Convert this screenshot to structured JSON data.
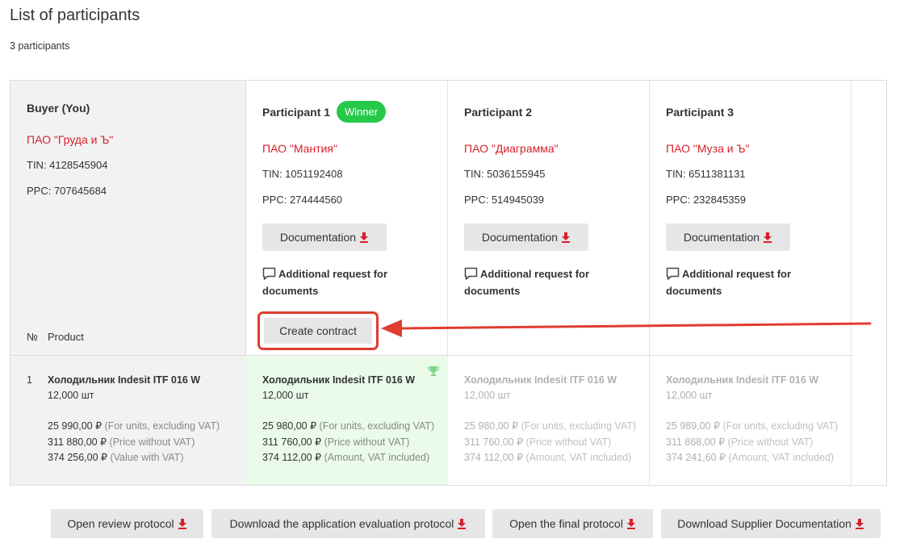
{
  "page": {
    "title": "List of participants",
    "count": "3 participants"
  },
  "buyer": {
    "heading": "Buyer (You)",
    "org": "ПАО \"Груда и Ъ\"",
    "tin": "TIN: 4128545904",
    "ppc": "PPC: 707645684",
    "col_no": "№",
    "col_product": "Product"
  },
  "participants": [
    {
      "heading": "Participant 1",
      "badge": "Winner",
      "org": "ПАО \"Мантия\"",
      "tin": "TIN: 1051192408",
      "ppc": "PPC: 274444560",
      "doc_label": "Documentation",
      "request_label": "Additional request for documents",
      "create_label": "Create contract",
      "item_name": "Холодильник Indesit ITF 016 W",
      "item_qty": "12,000 шт",
      "price_unit": "25 980,00 ₽",
      "price_unit_lbl": "(For units, excluding VAT)",
      "price_novat": "311 760,00 ₽",
      "price_novat_lbl": "(Price without VAT)",
      "price_vat": "374 112,00 ₽",
      "price_vat_lbl": "(Amount, VAT included)"
    },
    {
      "heading": "Participant 2",
      "org": "ПАО \"Диаграмма\"",
      "tin": "TIN: 5036155945",
      "ppc": "PPC: 514945039",
      "doc_label": "Documentation",
      "request_label": "Additional request for documents",
      "item_name": "Холодильник Indesit ITF 016 W",
      "item_qty": "12,000 шт",
      "price_unit": "25 980,00 ₽",
      "price_unit_lbl": "(For units, excluding VAT)",
      "price_novat": "311 760,00 ₽",
      "price_novat_lbl": "(Price without VAT)",
      "price_vat": "374 112,00 ₽",
      "price_vat_lbl": "(Amount, VAT included)"
    },
    {
      "heading": "Participant 3",
      "org": "ПАО \"Муза и Ъ\"",
      "tin": "TIN: 6511381131",
      "ppc": "PPC: 232845359",
      "doc_label": "Documentation",
      "request_label": "Additional request for documents",
      "item_name": "Холодильник Indesit ITF 016 W",
      "item_qty": "12,000 шт",
      "price_unit": "25 989,00 ₽",
      "price_unit_lbl": "(For units, excluding VAT)",
      "price_novat": "311 868,00 ₽",
      "price_novat_lbl": "(Price without VAT)",
      "price_vat": "374 241,60 ₽",
      "price_vat_lbl": "(Amount, VAT included)"
    }
  ],
  "buyer_item": {
    "no": "1",
    "name": "Холодильник Indesit ITF 016 W",
    "qty": "12,000 шт",
    "price_unit": "25 990,00 ₽",
    "price_unit_lbl": "(For units, excluding VAT)",
    "price_novat": "311 880,00 ₽",
    "price_novat_lbl": "(Price without VAT)",
    "price_vat": "374 256,00 ₽",
    "price_vat_lbl": "(Value with VAT)"
  },
  "bottom_buttons": {
    "review": "Open review protocol",
    "evaluation": "Download the application evaluation protocol",
    "final": "Open the final protocol",
    "supplier": "Download Supplier Documentation"
  },
  "colors": {
    "accent_red": "#d6202a",
    "winner_green": "#27c94b",
    "winner_bg": "#eafbea",
    "annotation_red": "#e03c31"
  },
  "icons": {
    "download": "download-arrow-icon",
    "chat": "chat-bubble-icon",
    "trophy": "trophy-icon"
  }
}
